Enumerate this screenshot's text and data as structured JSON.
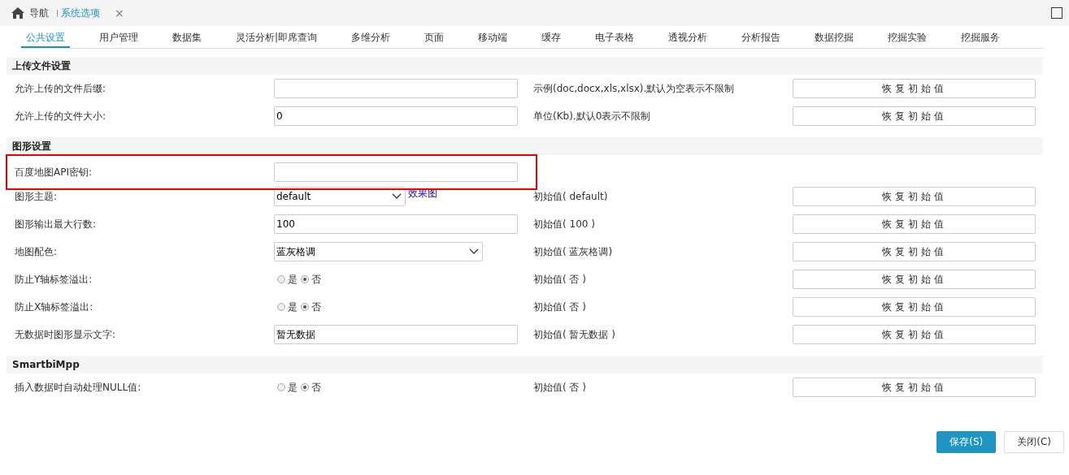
{
  "topbar": {
    "tabs": [
      {
        "label": "导航",
        "kind": "home",
        "selected": false
      },
      {
        "label": "系统选项",
        "kind": "closable",
        "selected": true,
        "close": "×"
      }
    ]
  },
  "tabs": [
    {
      "label": "公共设置",
      "selected": true
    },
    {
      "label": "用户管理",
      "selected": false
    },
    {
      "label": "数据集",
      "selected": false
    },
    {
      "label": "灵活分析|即席查询",
      "selected": false
    },
    {
      "label": "多维分析",
      "selected": false
    },
    {
      "label": "页面",
      "selected": false
    },
    {
      "label": "移动端",
      "selected": false
    },
    {
      "label": "缓存",
      "selected": false
    },
    {
      "label": "电子表格",
      "selected": false
    },
    {
      "label": "透视分析",
      "selected": false
    },
    {
      "label": "分析报告",
      "selected": false
    },
    {
      "label": "数据挖掘",
      "selected": false
    },
    {
      "label": "挖掘实验",
      "selected": false
    },
    {
      "label": "挖掘服务",
      "selected": false
    }
  ],
  "sections": [
    {
      "title": "上传文件设置",
      "rows": [
        {
          "kind": "text",
          "label": "允许上传的文件后缀:",
          "value": "",
          "hint": "示例(doc,docx,xls,xlsx).默认为空表示不限制",
          "reset": "恢复初始值"
        },
        {
          "kind": "text",
          "label": "允许上传的文件大小:",
          "value": "0",
          "hint": "单位(Kb).默认0表示不限制",
          "reset": "恢复初始值"
        }
      ]
    },
    {
      "title": "图形设置",
      "rows": [
        {
          "kind": "text",
          "label": "百度地图API密钥:",
          "value": "",
          "highlighted": true
        },
        {
          "kind": "select",
          "label": "图形主题:",
          "value": "default",
          "link": "效果图",
          "hint": "初始值( default)",
          "reset": "恢复初始值"
        },
        {
          "kind": "text",
          "label": "图形输出最大行数:",
          "value": "100",
          "hint": "初始值( 100 )",
          "reset": "恢复初始值"
        },
        {
          "kind": "select",
          "label": "地图配色:",
          "value": "蓝灰格调",
          "hint": "初始值( 蓝灰格调)",
          "reset": "恢复初始值"
        },
        {
          "kind": "radio",
          "label": "防止Y轴标签溢出:",
          "options": [
            {
              "label": "是",
              "selected": false
            },
            {
              "label": "否",
              "selected": true
            }
          ],
          "hint": "初始值( 否 )",
          "reset": "恢复初始值"
        },
        {
          "kind": "radio",
          "label": "防止X轴标签溢出:",
          "options": [
            {
              "label": "是",
              "selected": false
            },
            {
              "label": "否",
              "selected": true
            }
          ],
          "hint": "初始值( 否 )",
          "reset": "恢复初始值"
        },
        {
          "kind": "text",
          "label": "无数据时图形显示文字:",
          "value": "暂无数据",
          "hint": "初始值( 暂无数据 )",
          "reset": "恢复初始值"
        }
      ]
    },
    {
      "title": "SmartbiMpp",
      "rows": [
        {
          "kind": "radio",
          "label": "插入数据时自动处理NULL值:",
          "options": [
            {
              "label": "是",
              "selected": false
            },
            {
              "label": "否",
              "selected": true
            }
          ],
          "hint": "初始值( 否 )",
          "reset": "恢复初始值"
        }
      ]
    }
  ],
  "footer": {
    "buttons": [
      {
        "label": "保存(S)",
        "kind": "primary"
      },
      {
        "label": "关闭(C)",
        "kind": "default"
      }
    ]
  }
}
